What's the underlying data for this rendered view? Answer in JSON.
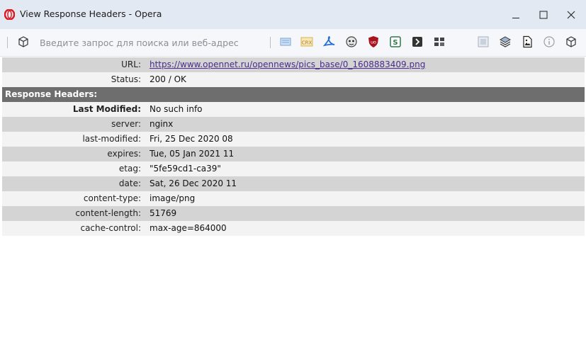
{
  "window": {
    "title": "View Response Headers - Opera"
  },
  "toolbar": {
    "address_placeholder": "Введите запрос для поиска или веб-адрес",
    "left_icon": "box-icon",
    "extension_icons": [
      "page-icon",
      "crx-icon",
      "pdf-icon",
      "ghost-icon",
      "ublock-icon",
      "s-icon",
      "terminal-icon",
      "grid-icon"
    ],
    "right_icons": [
      "screenshot-icon",
      "stack-icon",
      "image-icon",
      "info-icon",
      "box-icon"
    ],
    "crx_label": "CRX",
    "s_label": "S"
  },
  "info_rows": [
    {
      "key": "URL:",
      "value": "https://www.opennet.ru/opennews/pics_base/0_1608883409.png",
      "is_link": true
    },
    {
      "key": "Status:",
      "value": "200 / OK"
    }
  ],
  "section_title": "Response Headers:",
  "header_rows": [
    {
      "key": "Last Modified:",
      "value": "No such info"
    },
    {
      "key": "server:",
      "value": "nginx"
    },
    {
      "key": "last-modified:",
      "value": "Fri, 25 Dec 2020 08"
    },
    {
      "key": "expires:",
      "value": "Tue, 05 Jan 2021 11"
    },
    {
      "key": "etag:",
      "value": "\"5fe59cd1-ca39\""
    },
    {
      "key": "date:",
      "value": "Sat, 26 Dec 2020 11"
    },
    {
      "key": "content-type:",
      "value": "image/png"
    },
    {
      "key": "content-length:",
      "value": "51769"
    },
    {
      "key": "cache-control:",
      "value": "max-age=864000"
    }
  ],
  "colors": {
    "titlebar": "#e3e9f2",
    "row_dark": "#d4d4d4",
    "row_light": "#f3f3f3",
    "section_header": "#6e6e6e",
    "link": "#4b2c8c",
    "opera_red": "#e0121a"
  }
}
